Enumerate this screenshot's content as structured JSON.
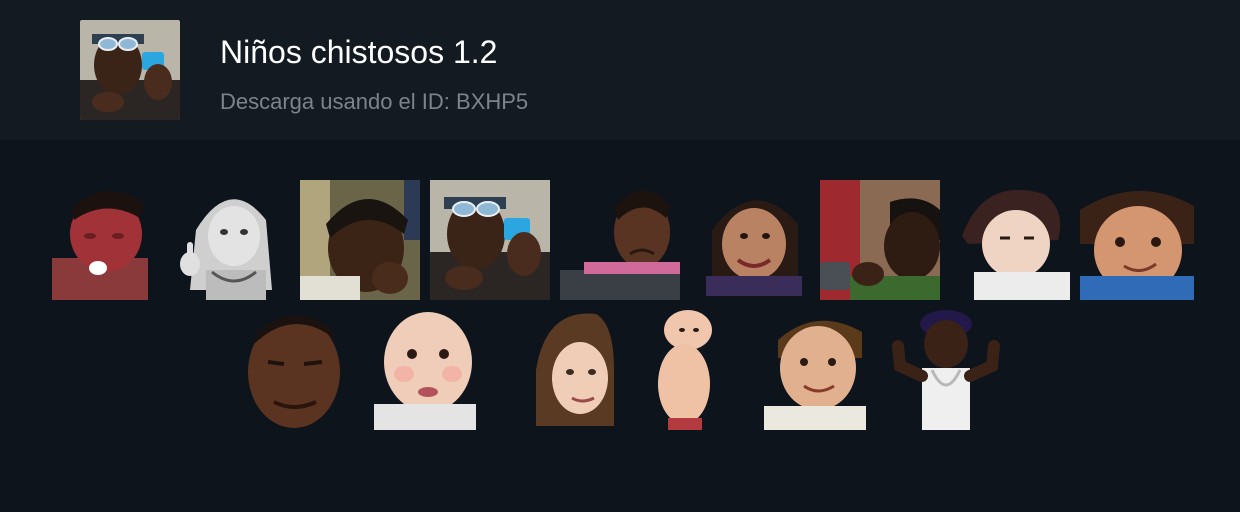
{
  "pack": {
    "title": "Niños chistosos 1.2",
    "download_text": "Descarga usando el ID: BXHP5",
    "cover_icon": "kid-with-sunglasses-and-phone-sticker"
  },
  "colors": {
    "background": "#0e141c",
    "header_background": "#131a22",
    "title": "#ffffff",
    "subtitle": "#7d838a"
  },
  "stickers": [
    {
      "name": "crying-red-face-kid-sticker"
    },
    {
      "name": "bw-girl-middle-finger-sticker"
    },
    {
      "name": "boy-covering-mouth-sticker"
    },
    {
      "name": "kid-with-sunglasses-and-phone-sticker"
    },
    {
      "name": "girl-grimacing-sticker"
    },
    {
      "name": "smiling-girl-sticker"
    },
    {
      "name": "boy-hand-on-mouth-phone-sticker"
    },
    {
      "name": "sleepy-baby-sticker"
    },
    {
      "name": "smirking-toddler-sticker"
    },
    {
      "name": "boy-squinting-sticker"
    },
    {
      "name": "big-cheeked-baby-sticker"
    },
    {
      "name": "disaster-girl-sticker"
    },
    {
      "name": "baby-side-eye-sticker"
    },
    {
      "name": "smiling-toddler-sticker"
    },
    {
      "name": "flexing-kid-sticker"
    }
  ]
}
